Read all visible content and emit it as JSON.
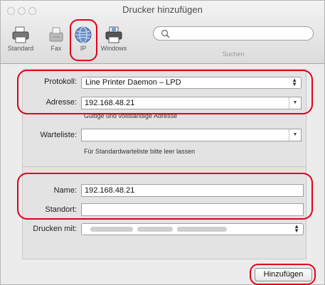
{
  "window": {
    "title": "Drucker hinzufügen"
  },
  "toolbar": {
    "items": [
      {
        "label": "Standard",
        "icon": "printer-icon"
      },
      {
        "label": "Fax",
        "icon": "fax-icon"
      },
      {
        "label": "IP",
        "icon": "globe-icon"
      },
      {
        "label": "Windows",
        "icon": "windows-printer-icon"
      }
    ],
    "selected": "IP"
  },
  "search": {
    "label": "Suchen",
    "placeholder": ""
  },
  "form": {
    "protocol": {
      "label": "Protokoll:",
      "value": "Line Printer Daemon – LPD"
    },
    "address": {
      "label": "Adresse:",
      "value": "192.168.48.21",
      "hint": "Gültige und vollständige Adresse"
    },
    "queue": {
      "label": "Warteliste:",
      "value": "",
      "hint": "Für Standardwarteliste bitte leer lassen"
    },
    "name": {
      "label": "Name:",
      "value": "192.168.48.21"
    },
    "location": {
      "label": "Standort:",
      "value": ""
    },
    "driver": {
      "label": "Drucken mit:",
      "value": ""
    }
  },
  "buttons": {
    "add": "Hinzufügen"
  },
  "colors": {
    "highlight": "#e0001a",
    "window_bg": "#ececec"
  }
}
